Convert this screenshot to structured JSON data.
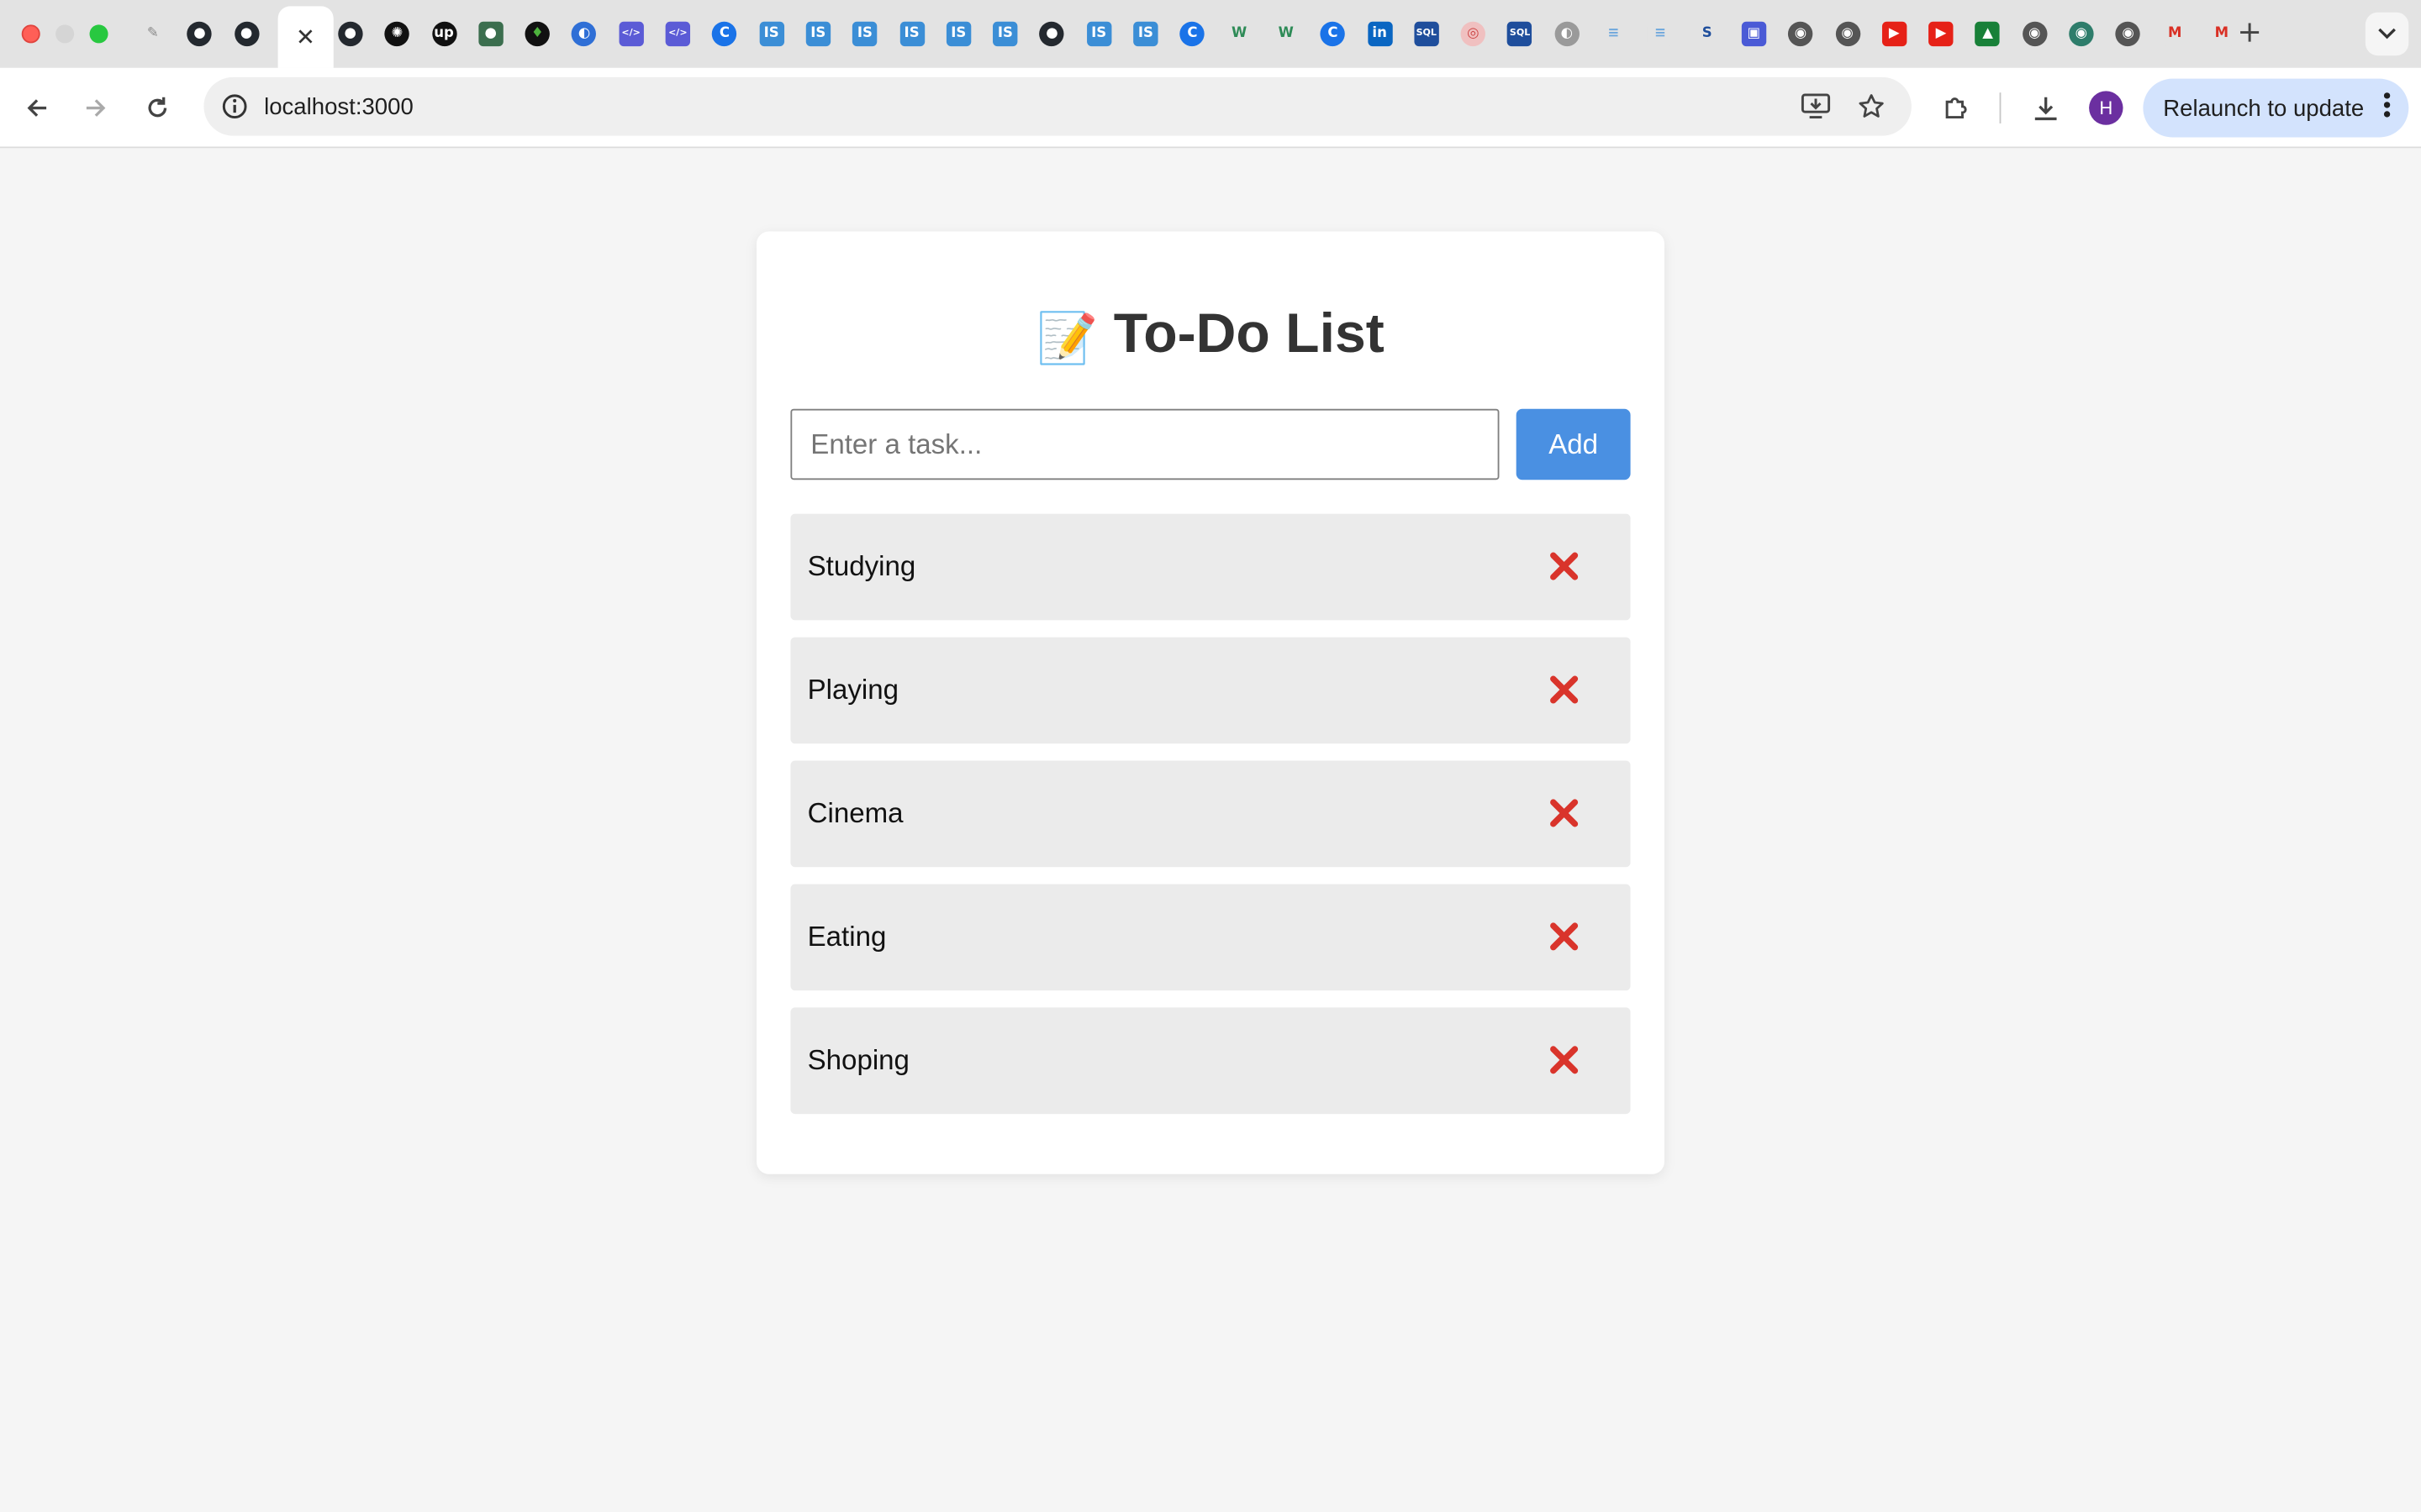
{
  "browser": {
    "url": "localhost:3000",
    "relaunch_label": "Relaunch to update",
    "profile_initial": "H",
    "tabs": [
      {
        "icon": "bird-icon",
        "bg": "#e3e3e3",
        "fg": "#888",
        "glyph": "✎"
      },
      {
        "icon": "github-icon",
        "bg": "#24292f",
        "fg": "#fff",
        "glyph": "●"
      },
      {
        "icon": "github-icon",
        "bg": "#24292f",
        "fg": "#fff",
        "glyph": "●"
      },
      {
        "icon": "github-icon",
        "bg": "#24292f",
        "fg": "#fff",
        "glyph": "●"
      },
      {
        "icon": "openai-icon",
        "bg": "#111111",
        "fg": "#fff",
        "glyph": "✺"
      },
      {
        "icon": "upwork-icon",
        "bg": "#111111",
        "fg": "#fff",
        "glyph": "up"
      },
      {
        "icon": "app-icon",
        "bg": "#3b6e4e",
        "fg": "#fff",
        "glyph": "●"
      },
      {
        "icon": "mongodb-icon",
        "bg": "#111111",
        "fg": "#4db33d",
        "glyph": "♦"
      },
      {
        "icon": "globe-icon",
        "bg": "#2f6fd6",
        "fg": "#fff",
        "glyph": "◐"
      },
      {
        "icon": "code-icon",
        "bg": "#5b5bd6",
        "fg": "#fff",
        "glyph": "</>"
      },
      {
        "icon": "code-icon",
        "bg": "#5b5bd6",
        "fg": "#fff",
        "glyph": "</>"
      },
      {
        "icon": "c-icon",
        "bg": "#1a73e8",
        "fg": "#fff",
        "glyph": "C"
      },
      {
        "icon": "is-icon",
        "bg": "#3b8ed6",
        "fg": "#fff",
        "glyph": "IS"
      },
      {
        "icon": "is-icon",
        "bg": "#3b8ed6",
        "fg": "#fff",
        "glyph": "IS"
      },
      {
        "icon": "is-icon",
        "bg": "#3b8ed6",
        "fg": "#fff",
        "glyph": "IS"
      },
      {
        "icon": "is-icon",
        "bg": "#3b8ed6",
        "fg": "#fff",
        "glyph": "IS"
      },
      {
        "icon": "is-icon",
        "bg": "#3b8ed6",
        "fg": "#fff",
        "glyph": "IS"
      },
      {
        "icon": "is-icon",
        "bg": "#3b8ed6",
        "fg": "#fff",
        "glyph": "IS"
      },
      {
        "icon": "github-icon",
        "bg": "#24292f",
        "fg": "#fff",
        "glyph": "●"
      },
      {
        "icon": "is-icon",
        "bg": "#3b8ed6",
        "fg": "#fff",
        "glyph": "IS"
      },
      {
        "icon": "is-icon",
        "bg": "#3b8ed6",
        "fg": "#fff",
        "glyph": "IS"
      },
      {
        "icon": "c-icon",
        "bg": "#1a73e8",
        "fg": "#fff",
        "glyph": "C"
      },
      {
        "icon": "w3-icon",
        "bg": "#e3e3e3",
        "fg": "#2e8b57",
        "glyph": "W"
      },
      {
        "icon": "w3-icon",
        "bg": "#e3e3e3",
        "fg": "#2e8b57",
        "glyph": "W"
      },
      {
        "icon": "c-icon",
        "bg": "#1a73e8",
        "fg": "#fff",
        "glyph": "C"
      },
      {
        "icon": "linkedin-icon",
        "bg": "#0a66c2",
        "fg": "#fff",
        "glyph": "in"
      },
      {
        "icon": "sql-icon",
        "bg": "#1f4e9c",
        "fg": "#fff",
        "glyph": "SQL"
      },
      {
        "icon": "target-icon",
        "bg": "#f0c0c0",
        "fg": "#c44",
        "glyph": "◎"
      },
      {
        "icon": "sql-icon",
        "bg": "#1f4e9c",
        "fg": "#fff",
        "glyph": "SQL"
      },
      {
        "icon": "globe-icon",
        "bg": "#9a9a9a",
        "fg": "#fff",
        "glyph": "◐"
      },
      {
        "icon": "database-icon",
        "bg": "#e3e3e3",
        "fg": "#6fa8dc",
        "glyph": "≡"
      },
      {
        "icon": "database-icon",
        "bg": "#e3e3e3",
        "fg": "#6fa8dc",
        "glyph": "≡"
      },
      {
        "icon": "s-icon",
        "bg": "#e3e3e3",
        "fg": "#1f4e9c",
        "glyph": "S"
      },
      {
        "icon": "image-icon",
        "bg": "#4a5ad6",
        "fg": "#fff",
        "glyph": "▣"
      },
      {
        "icon": "chrome-icon",
        "bg": "#555555",
        "fg": "#fff",
        "glyph": "◉"
      },
      {
        "icon": "chrome-icon",
        "bg": "#555555",
        "fg": "#fff",
        "glyph": "◉"
      },
      {
        "icon": "youtube-icon",
        "bg": "#e62117",
        "fg": "#fff",
        "glyph": "▶"
      },
      {
        "icon": "youtube-icon",
        "bg": "#e62117",
        "fg": "#fff",
        "glyph": "▶"
      },
      {
        "icon": "contacts-icon",
        "bg": "#188038",
        "fg": "#fff",
        "glyph": "▲"
      },
      {
        "icon": "chrome-icon",
        "bg": "#555555",
        "fg": "#fff",
        "glyph": "◉"
      },
      {
        "icon": "chrome-icon",
        "bg": "#2e7d6b",
        "fg": "#fff",
        "glyph": "◉"
      },
      {
        "icon": "chrome-icon",
        "bg": "#555555",
        "fg": "#fff",
        "glyph": "◉"
      },
      {
        "icon": "gmail-icon",
        "bg": "#e3e3e3",
        "fg": "#d93025",
        "glyph": "M"
      },
      {
        "icon": "gmail-icon",
        "bg": "#e3e3e3",
        "fg": "#d93025",
        "glyph": "M"
      }
    ]
  },
  "app": {
    "title_emoji": "📝",
    "title": "To-Do List",
    "input_placeholder": "Enter a task...",
    "input_value": "",
    "add_label": "Add",
    "accent_color": "#4a90e2",
    "delete_icon_color": "#d9342b",
    "tasks": [
      {
        "label": "Studying"
      },
      {
        "label": "Playing"
      },
      {
        "label": "Cinema"
      },
      {
        "label": "Eating"
      },
      {
        "label": "Shoping"
      }
    ]
  }
}
